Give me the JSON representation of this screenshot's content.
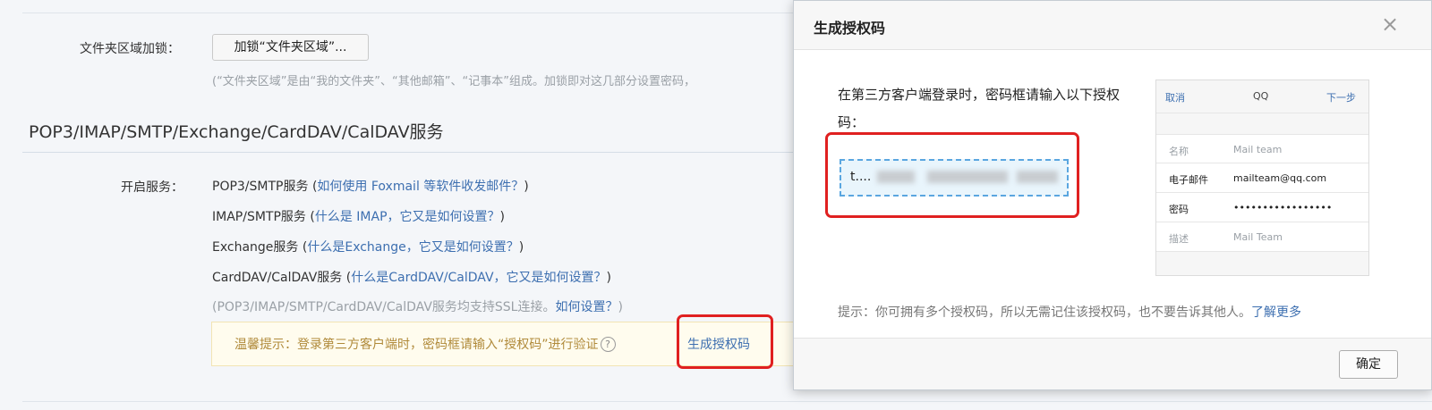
{
  "folder_lock": {
    "label": "文件夹区域加锁：",
    "button_label": "加锁“文件夹区域”...",
    "note": "(“文件夹区域”是由“我的文件夹”、“其他邮箱”、“记事本”组成。加锁即对这几部分设置密码，"
  },
  "services": {
    "section_title": "POP3/IMAP/SMTP/Exchange/CardDAV/CalDAV服务",
    "enable_label": "开启服务：",
    "items": [
      {
        "name": "POP3/SMTP服务",
        "open_paren": " (",
        "help_link": "如何使用 Foxmail 等软件收发邮件？",
        "close_paren": ")"
      },
      {
        "name": "IMAP/SMTP服务",
        "open_paren": " (",
        "help_link": "什么是 IMAP，它又是如何设置？",
        "close_paren": ")"
      },
      {
        "name": "Exchange服务",
        "open_paren": " (",
        "help_link": "什么是Exchange，它又是如何设置？",
        "close_paren": ")"
      },
      {
        "name": "CardDAV/CalDAV服务",
        "open_paren": " (",
        "help_link": "什么是CardDAV/CalDAV，它又是如何设置？",
        "close_paren": ")"
      }
    ],
    "ssl_note": "(POP3/IMAP/SMTP/CardDAV/CalDAV服务均支持SSL连接。",
    "ssl_link": "如何设置？",
    "ssl_close": ")",
    "tip_text": "温馨提示：登录第三方客户端时，密码框请输入“授权码”进行验证",
    "tip_help_icon": "?",
    "generate_link": "生成授权码"
  },
  "modal": {
    "title": "生成授权码",
    "close_icon": "×",
    "instruction": "在第三方客户端登录时，密码框请输入以下授权码：",
    "auth_code": "t....",
    "hint_text": "提示：你可拥有多个授权码，所以无需记住该授权码，也不要告诉其他人。",
    "learn_more": "了解更多",
    "ok_button": "确定",
    "phone": {
      "cancel": "取消",
      "title": "QQ",
      "next": "下一步",
      "rows": [
        {
          "label": "名称",
          "value": "Mail team"
        },
        {
          "label": "电子邮件",
          "value": "mailteam@qq.com"
        },
        {
          "label": "密码",
          "value": "•••••••••••••••••"
        },
        {
          "label": "描述",
          "value": "Mail Team"
        }
      ]
    }
  }
}
